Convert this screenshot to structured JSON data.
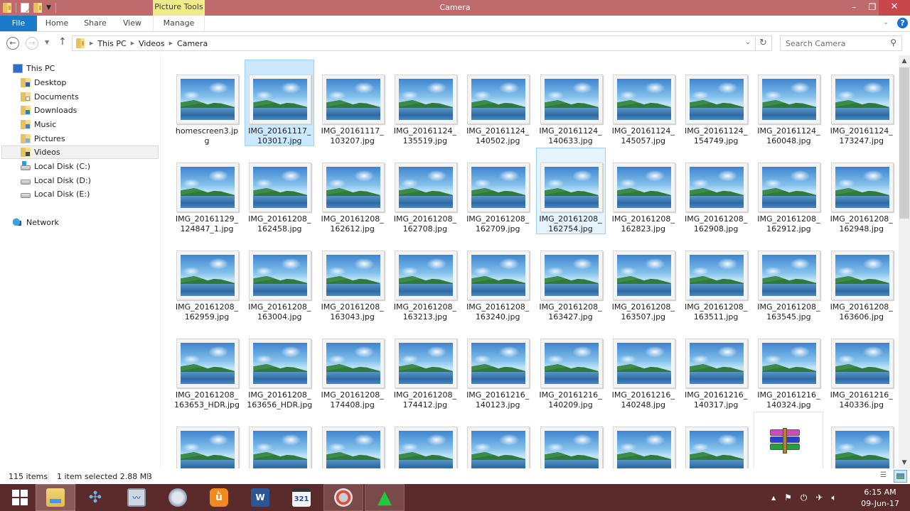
{
  "window": {
    "title": "Camera",
    "context_tab_group": "Picture Tools",
    "controls": {
      "minimize": "–",
      "restore": "❐",
      "close": "✕"
    }
  },
  "ribbon": {
    "tabs": [
      {
        "label": "File",
        "active": true
      },
      {
        "label": "Home"
      },
      {
        "label": "Share"
      },
      {
        "label": "View"
      },
      {
        "label": "Manage"
      }
    ],
    "help": "?"
  },
  "navigation": {
    "back": "←",
    "forward": "→",
    "up": "↑",
    "breadcrumb": [
      "This PC",
      "Videos",
      "Camera"
    ],
    "search_placeholder": "Search Camera"
  },
  "nav_pane": {
    "items": [
      {
        "label": "This PC",
        "icon": "computer-icon",
        "level": 0
      },
      {
        "label": "Desktop",
        "icon": "desktop-folder-icon",
        "level": 1
      },
      {
        "label": "Documents",
        "icon": "documents-folder-icon",
        "level": 1
      },
      {
        "label": "Downloads",
        "icon": "downloads-folder-icon",
        "level": 1
      },
      {
        "label": "Music",
        "icon": "music-folder-icon",
        "level": 1
      },
      {
        "label": "Pictures",
        "icon": "pictures-folder-icon",
        "level": 1
      },
      {
        "label": "Videos",
        "icon": "videos-folder-icon",
        "level": 1,
        "selected": true
      },
      {
        "label": "Local Disk (C:)",
        "icon": "system-drive-icon",
        "level": 1
      },
      {
        "label": "Local Disk (D:)",
        "icon": "drive-icon",
        "level": 1
      },
      {
        "label": "Local Disk (E:)",
        "icon": "drive-icon",
        "level": 1
      },
      {
        "label": "Network",
        "icon": "network-icon",
        "level": 0
      }
    ]
  },
  "files": [
    {
      "name": "homescreen3.jpg",
      "type": "image"
    },
    {
      "name": "IMG_20161117_103017.jpg",
      "type": "image",
      "state": "selected"
    },
    {
      "name": "IMG_20161117_103207.jpg",
      "type": "image"
    },
    {
      "name": "IMG_20161124_135519.jpg",
      "type": "image"
    },
    {
      "name": "IMG_20161124_140502.jpg",
      "type": "image"
    },
    {
      "name": "IMG_20161124_140633.jpg",
      "type": "image"
    },
    {
      "name": "IMG_20161124_145057.jpg",
      "type": "image"
    },
    {
      "name": "IMG_20161124_154749.jpg",
      "type": "image"
    },
    {
      "name": "IMG_20161124_160048.jpg",
      "type": "image"
    },
    {
      "name": "IMG_20161124_173247.jpg",
      "type": "image"
    },
    {
      "name": "IMG_20161129_124847_1.jpg",
      "type": "image"
    },
    {
      "name": "IMG_20161208_162458.jpg",
      "type": "image"
    },
    {
      "name": "IMG_20161208_162612.jpg",
      "type": "image"
    },
    {
      "name": "IMG_20161208_162708.jpg",
      "type": "image"
    },
    {
      "name": "IMG_20161208_162709.jpg",
      "type": "image"
    },
    {
      "name": "IMG_20161208_162754.jpg",
      "type": "image",
      "state": "focused"
    },
    {
      "name": "IMG_20161208_162823.jpg",
      "type": "image"
    },
    {
      "name": "IMG_20161208_162908.jpg",
      "type": "image"
    },
    {
      "name": "IMG_20161208_162912.jpg",
      "type": "image"
    },
    {
      "name": "IMG_20161208_162948.jpg",
      "type": "image"
    },
    {
      "name": "IMG_20161208_162959.jpg",
      "type": "image"
    },
    {
      "name": "IMG_20161208_163004.jpg",
      "type": "image"
    },
    {
      "name": "IMG_20161208_163043.jpg",
      "type": "image"
    },
    {
      "name": "IMG_20161208_163213.jpg",
      "type": "image"
    },
    {
      "name": "IMG_20161208_163240.jpg",
      "type": "image"
    },
    {
      "name": "IMG_20161208_163427.jpg",
      "type": "image"
    },
    {
      "name": "IMG_20161208_163507.jpg",
      "type": "image"
    },
    {
      "name": "IMG_20161208_163511.jpg",
      "type": "image"
    },
    {
      "name": "IMG_20161208_163545.jpg",
      "type": "image"
    },
    {
      "name": "IMG_20161208_163606.jpg",
      "type": "image"
    },
    {
      "name": "IMG_20161208_163653_HDR.jpg",
      "type": "image"
    },
    {
      "name": "IMG_20161208_163656_HDR.jpg",
      "type": "image"
    },
    {
      "name": "IMG_20161208_174408.jpg",
      "type": "image"
    },
    {
      "name": "IMG_20161208_174412.jpg",
      "type": "image"
    },
    {
      "name": "IMG_20161216_140123.jpg",
      "type": "image"
    },
    {
      "name": "IMG_20161216_140209.jpg",
      "type": "image"
    },
    {
      "name": "IMG_20161216_140248.jpg",
      "type": "image"
    },
    {
      "name": "IMG_20161216_140317.jpg",
      "type": "image"
    },
    {
      "name": "IMG_20161216_140324.jpg",
      "type": "image"
    },
    {
      "name": "IMG_20161216_140336.jpg",
      "type": "image"
    },
    {
      "name": "",
      "type": "image"
    },
    {
      "name": "",
      "type": "image"
    },
    {
      "name": "",
      "type": "image"
    },
    {
      "name": "",
      "type": "image"
    },
    {
      "name": "",
      "type": "image"
    },
    {
      "name": "",
      "type": "image"
    },
    {
      "name": "",
      "type": "image"
    },
    {
      "name": "",
      "type": "image"
    },
    {
      "name": "",
      "type": "archive",
      "state": "hover"
    },
    {
      "name": "",
      "type": "image"
    }
  ],
  "status": {
    "item_count": "115 items",
    "selection": "1 item selected  2.88 MB"
  },
  "taskbar": {
    "apps": [
      {
        "name": "start",
        "icon": "windows-start-icon"
      },
      {
        "name": "File Explorer",
        "icon": "file-explorer-icon",
        "state": "active"
      },
      {
        "name": "PPSSPP",
        "icon": "ppsspp-icon"
      },
      {
        "name": "Resource Monitor",
        "icon": "resource-monitor-icon"
      },
      {
        "name": "Disk utility",
        "icon": "disk-utility-icon"
      },
      {
        "name": "UC Browser",
        "icon": "uc-browser-icon"
      },
      {
        "name": "Word",
        "icon": "word-icon",
        "letter": "W"
      },
      {
        "name": "Media Player Classic",
        "icon": "media-player-icon",
        "letter": "321"
      },
      {
        "name": "Recovery tool",
        "icon": "recovery-tool-icon",
        "state": "open"
      },
      {
        "name": "Green triangle app",
        "icon": "green-triangle-app-icon",
        "state": "open"
      }
    ],
    "tray": [
      "show-hidden-icons",
      "action-center-flag-icon",
      "power-status-icon",
      "airplane-mode-icon",
      "volume-icon"
    ],
    "time": "6:15 AM",
    "date": "09-Jun-17"
  },
  "colors": {
    "titlebar": "#be6b6c",
    "file_tab": "#1979ca",
    "context_tab": "#f1ec8a",
    "selection_bg": "#cce8ff",
    "selection_border": "#99d1ff",
    "taskbar": "#5b2a2b"
  }
}
